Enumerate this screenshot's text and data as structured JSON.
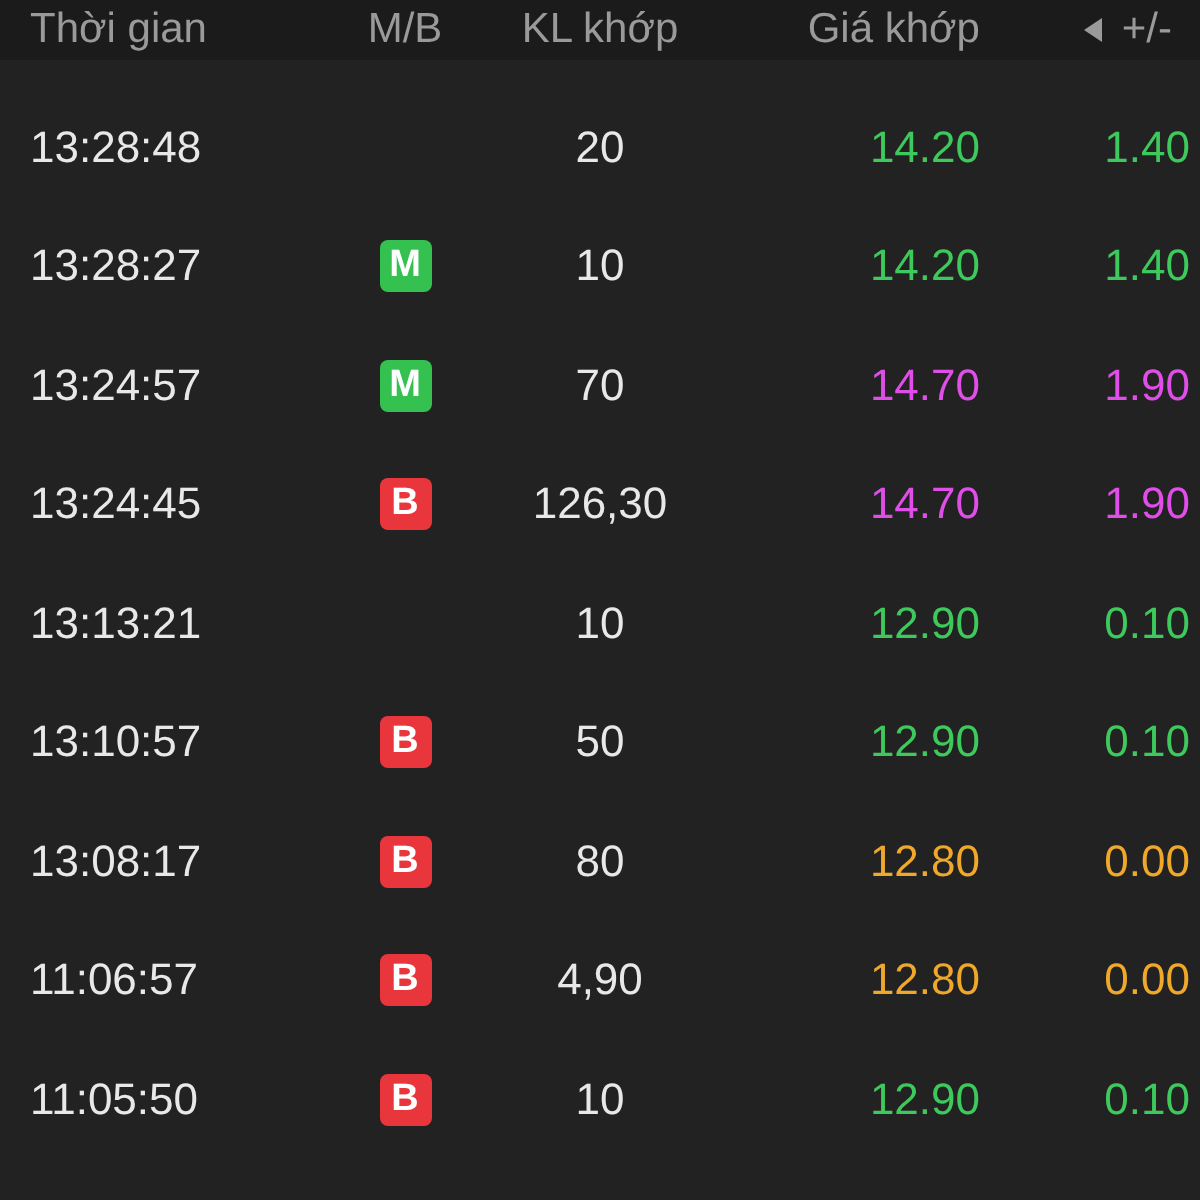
{
  "header": {
    "columns": [
      "Thời gian",
      "M/B",
      "KL khớp",
      "Giá khớp",
      "+/-"
    ]
  },
  "rows": [
    {
      "time": "13:28:48",
      "volume": "20",
      "price": "14.20",
      "change": "1.40",
      "color": "#3ec95c"
    },
    {
      "time": "13:28:27",
      "side": {
        "kind": "buy",
        "label": "M"
      },
      "volume": "10",
      "price": "14.20",
      "change": "1.40",
      "color": "#3ec95c"
    },
    {
      "time": "13:24:57",
      "side": {
        "kind": "buy",
        "label": "M"
      },
      "volume": "70",
      "price": "14.70",
      "change": "1.90",
      "color": "#e04ee8"
    },
    {
      "time": "13:24:45",
      "side": {
        "kind": "sell",
        "label": "B"
      },
      "volume": "126,30",
      "price": "14.70",
      "change": "1.90",
      "color": "#e04ee8"
    },
    {
      "time": "13:13:21",
      "volume": "10",
      "price": "12.90",
      "change": "0.10",
      "color": "#3ec95c"
    },
    {
      "time": "13:10:57",
      "side": {
        "kind": "sell",
        "label": "B"
      },
      "volume": "50",
      "price": "12.90",
      "change": "0.10",
      "color": "#3ec95c"
    },
    {
      "time": "13:08:17",
      "side": {
        "kind": "sell",
        "label": "B"
      },
      "volume": "80",
      "price": "12.80",
      "change": "0.00",
      "color": "#f0a82a"
    },
    {
      "time": "11:06:57",
      "side": {
        "kind": "sell",
        "label": "B"
      },
      "volume": "4,90",
      "price": "12.80",
      "change": "0.00",
      "color": "#f0a82a"
    },
    {
      "time": "11:05:50",
      "side": {
        "kind": "sell",
        "label": "B"
      },
      "volume": "10",
      "price": "12.90",
      "change": "0.10",
      "color": "#3ec95c"
    }
  ]
}
